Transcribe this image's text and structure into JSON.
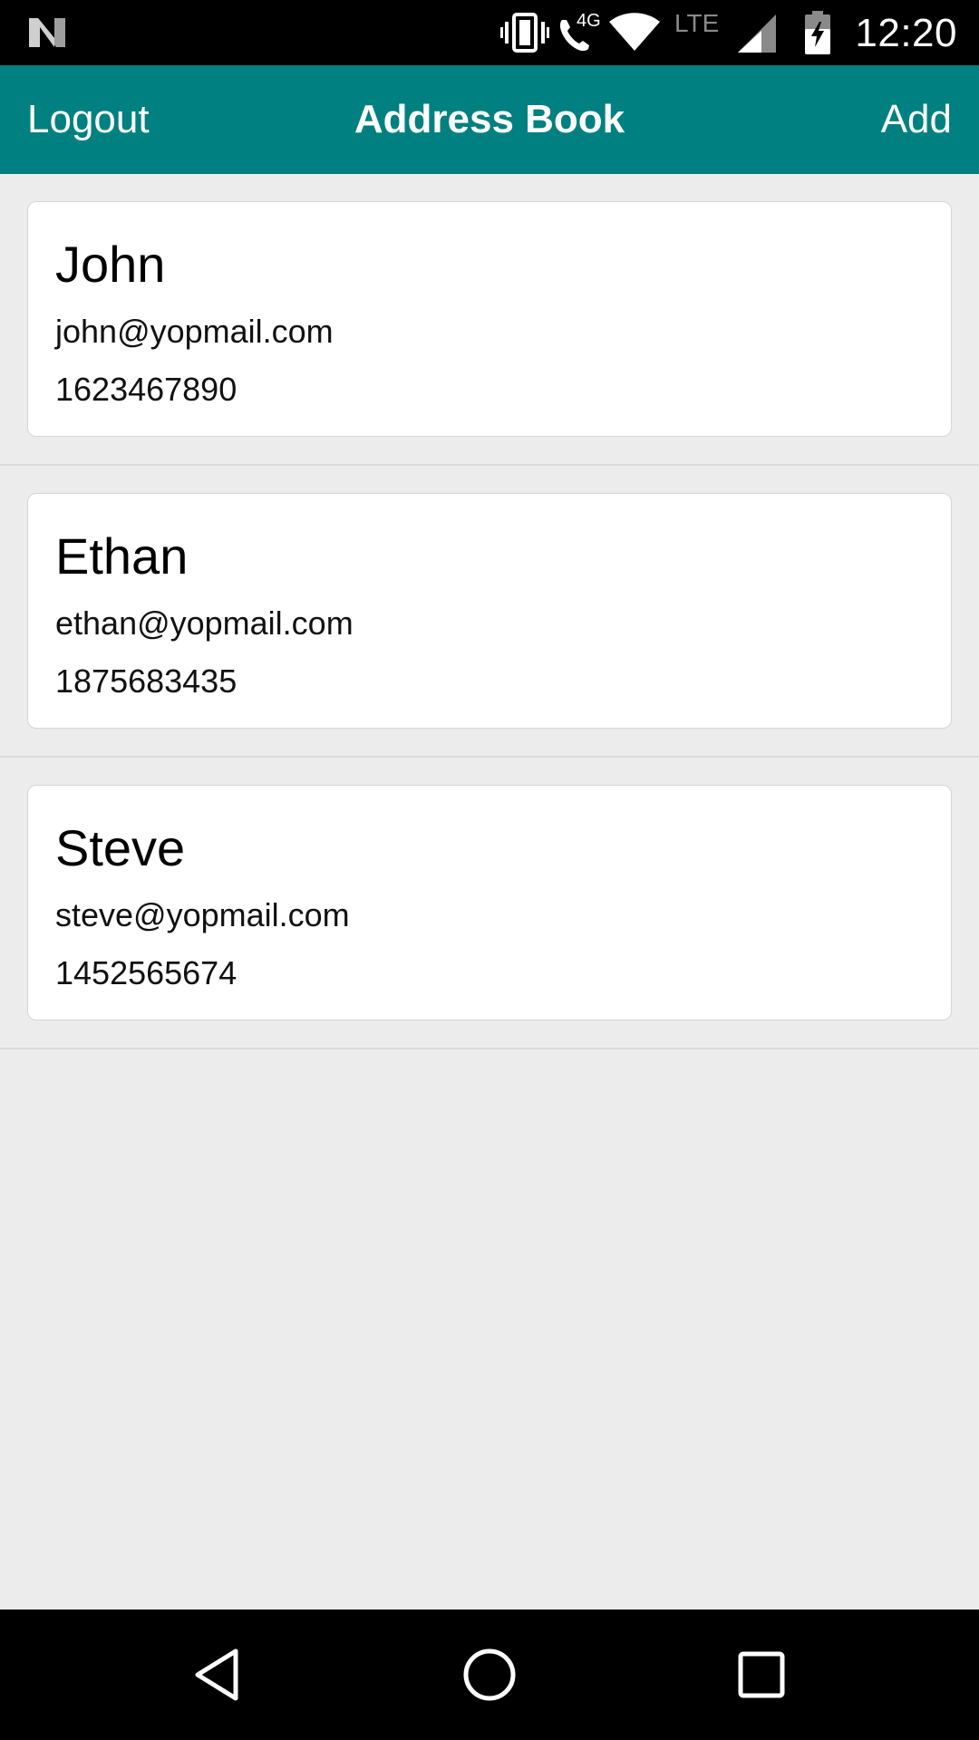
{
  "status_bar": {
    "time": "12:20",
    "network_label": "4G",
    "lte_label": "LTE",
    "icons": [
      "n-logo-icon",
      "vibrate-icon",
      "wifi-call-icon",
      "wifi-icon",
      "signal-icon",
      "battery-charging-icon"
    ]
  },
  "app_bar": {
    "left_label": "Logout",
    "title": "Address Book",
    "right_label": "Add",
    "color": "#008080"
  },
  "contacts": [
    {
      "name": "John",
      "email": "john@yopmail.com",
      "phone": "1623467890"
    },
    {
      "name": "Ethan",
      "email": "ethan@yopmail.com",
      "phone": "1875683435"
    },
    {
      "name": "Steve",
      "email": "steve@yopmail.com",
      "phone": "1452565674"
    }
  ],
  "nav_bar": {
    "icons": [
      "back-icon",
      "home-icon",
      "recents-icon"
    ]
  }
}
